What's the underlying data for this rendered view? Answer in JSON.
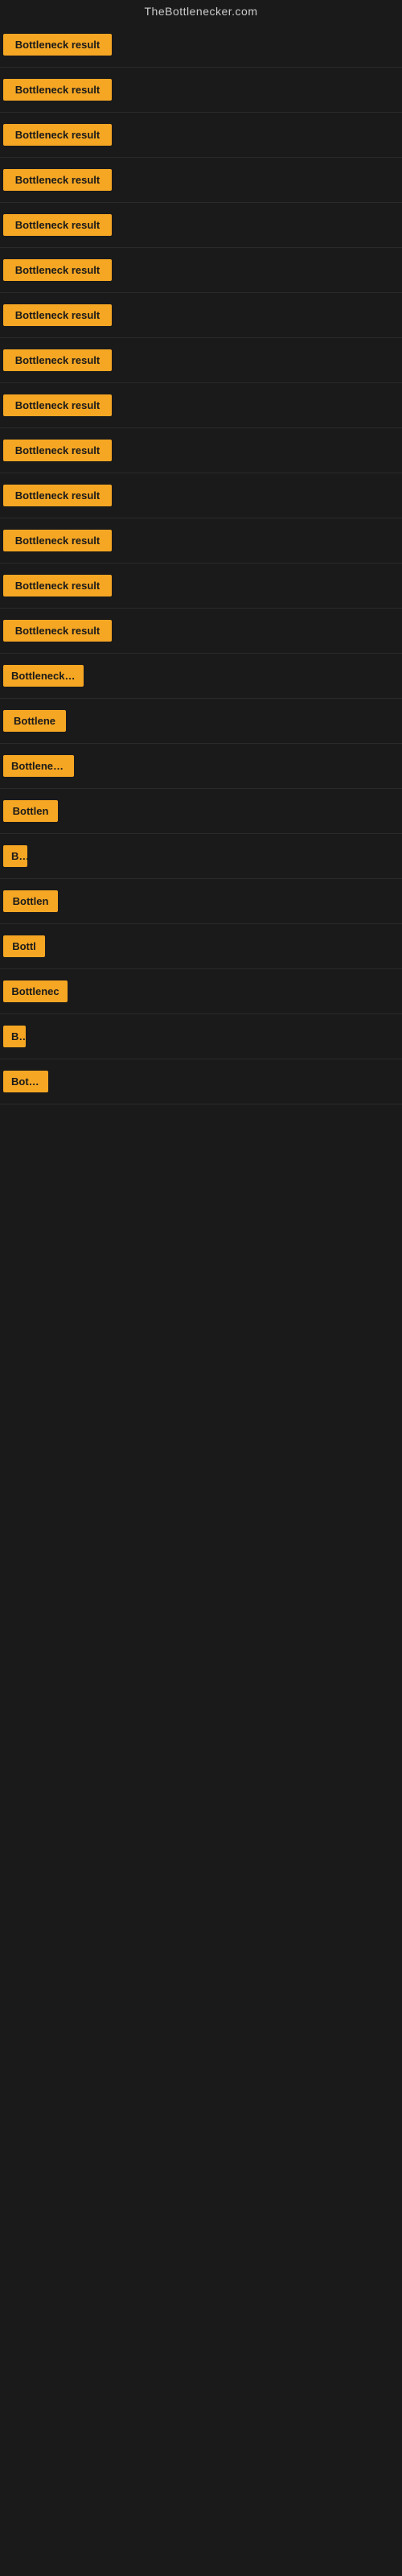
{
  "site": {
    "title": "TheBottlenecker.com"
  },
  "buttons": [
    {
      "id": 1,
      "label": "Bottleneck result",
      "width": 135
    },
    {
      "id": 2,
      "label": "Bottleneck result",
      "width": 135
    },
    {
      "id": 3,
      "label": "Bottleneck result",
      "width": 135
    },
    {
      "id": 4,
      "label": "Bottleneck result",
      "width": 135
    },
    {
      "id": 5,
      "label": "Bottleneck result",
      "width": 135
    },
    {
      "id": 6,
      "label": "Bottleneck result",
      "width": 135
    },
    {
      "id": 7,
      "label": "Bottleneck result",
      "width": 135
    },
    {
      "id": 8,
      "label": "Bottleneck result",
      "width": 135
    },
    {
      "id": 9,
      "label": "Bottleneck result",
      "width": 135
    },
    {
      "id": 10,
      "label": "Bottleneck result",
      "width": 135
    },
    {
      "id": 11,
      "label": "Bottleneck result",
      "width": 135
    },
    {
      "id": 12,
      "label": "Bottleneck result",
      "width": 135
    },
    {
      "id": 13,
      "label": "Bottleneck result",
      "width": 135
    },
    {
      "id": 14,
      "label": "Bottleneck result",
      "width": 135
    },
    {
      "id": 15,
      "label": "Bottleneck re",
      "width": 100
    },
    {
      "id": 16,
      "label": "Bottlene",
      "width": 78
    },
    {
      "id": 17,
      "label": "Bottleneck r",
      "width": 88
    },
    {
      "id": 18,
      "label": "Bottlen",
      "width": 68
    },
    {
      "id": 19,
      "label": "Bo",
      "width": 30
    },
    {
      "id": 20,
      "label": "Bottlen",
      "width": 68
    },
    {
      "id": 21,
      "label": "Bottl",
      "width": 52
    },
    {
      "id": 22,
      "label": "Bottlenec",
      "width": 80
    },
    {
      "id": 23,
      "label": "Bo",
      "width": 28
    },
    {
      "id": 24,
      "label": "Bottle",
      "width": 56
    }
  ]
}
